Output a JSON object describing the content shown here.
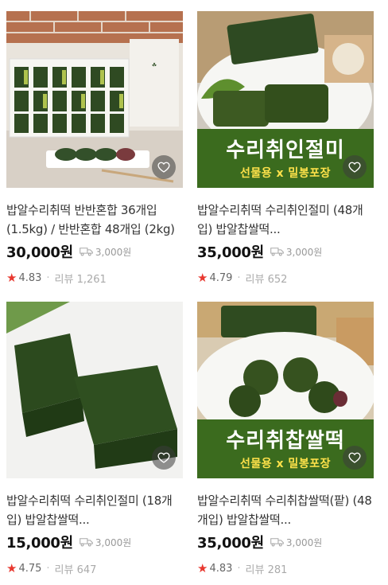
{
  "products": [
    {
      "title": "밥알수리취떡 반반혼합 36개입 (1.5kg) / 반반혼합 48개입 (2kg)",
      "price": "30,000원",
      "shipping": "3,000원",
      "rating": "4.83",
      "reviews": "리뷰 1,261",
      "banner_main": "",
      "banner_sub": ""
    },
    {
      "title": "밥알수리취떡 수리취인절미 (48개입) 밥알찹쌀떡...",
      "price": "35,000원",
      "shipping": "3,000원",
      "rating": "4.79",
      "reviews": "리뷰 652",
      "banner_main": "수리취인절미",
      "banner_sub": "선물용 x 밀봉포장"
    },
    {
      "title": "밥알수리취떡 수리취인절미 (18개입) 밥알찹쌀떡...",
      "price": "15,000원",
      "shipping": "3,000원",
      "rating": "4.75",
      "reviews": "리뷰 647",
      "banner_main": "",
      "banner_sub": ""
    },
    {
      "title": "밥알수리취떡 수리취찹쌀떡(팥) (48개입) 밥알찹쌀떡...",
      "price": "35,000원",
      "shipping": "3,000원",
      "rating": "4.83",
      "reviews": "리뷰 281",
      "banner_main": "수리취찹쌀떡",
      "banner_sub": "선물용 x 밀봉포장"
    }
  ],
  "icons": {
    "wishlist": "heart-outline-icon",
    "shipping": "truck-icon",
    "rating": "star-icon"
  },
  "colors": {
    "star": "#e8382f",
    "banner_bg": "#3b6b1e",
    "banner_sub": "#ffe24a"
  }
}
